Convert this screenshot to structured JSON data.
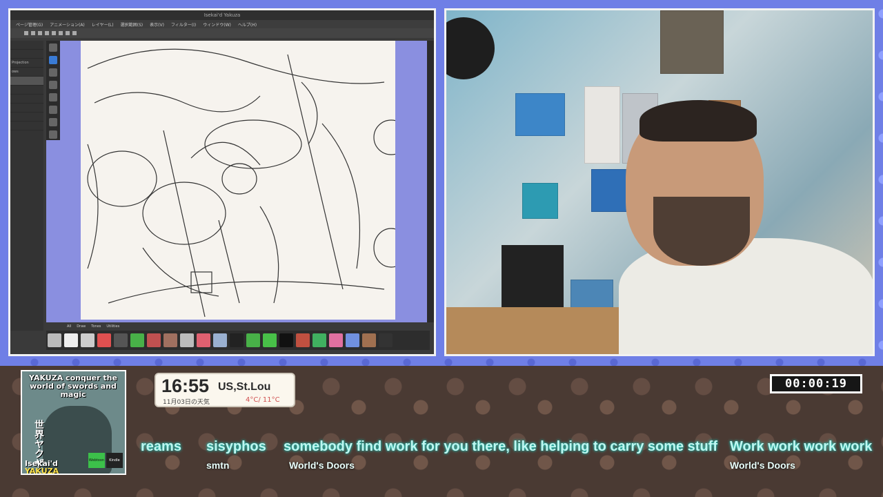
{
  "app": {
    "title": "Isekai'd Yakuza",
    "menu": [
      "ページ管理(G)",
      "アニメーション(A)",
      "レイヤー(L)",
      "選択範囲(S)",
      "表示(V)",
      "フィルター(I)",
      "ウィンドウ(W)",
      "ヘルプ(H)"
    ],
    "panel_rows": [
      "",
      "",
      "Projection",
      "ows",
      "",
      "",
      "",
      "",
      "",
      "",
      "",
      ""
    ],
    "brush_tabs": [
      "All",
      "Draw",
      "Tones",
      "Utilities"
    ]
  },
  "overlay": {
    "book": {
      "title": "YAKUZA conquer the world of swords and magic",
      "kanji": "世界ヤクザ",
      "sub1": "Isekai'd",
      "sub2": "YAKUZA",
      "badge1": "Webtoon",
      "badge2": "Kindle"
    },
    "clock": {
      "time": "16:55",
      "location": "US,St.Lou",
      "date": "11月03日の天気",
      "temp": "4°C/ 11°C"
    },
    "timer": "00:00:19"
  },
  "chat": [
    {
      "message": "reams",
      "author": ""
    },
    {
      "message": "sisyphos",
      "author": "smtn"
    },
    {
      "message": "somebody find work for you there, like helping to carry some stuff",
      "author": "World's Doors"
    },
    {
      "message": "Work work work work",
      "author": "World's Doors"
    }
  ],
  "colors": {
    "accent_blue": "#6f7fe6",
    "ticker_glow": "#2ee0d0",
    "clock_temp": "#d05050"
  }
}
